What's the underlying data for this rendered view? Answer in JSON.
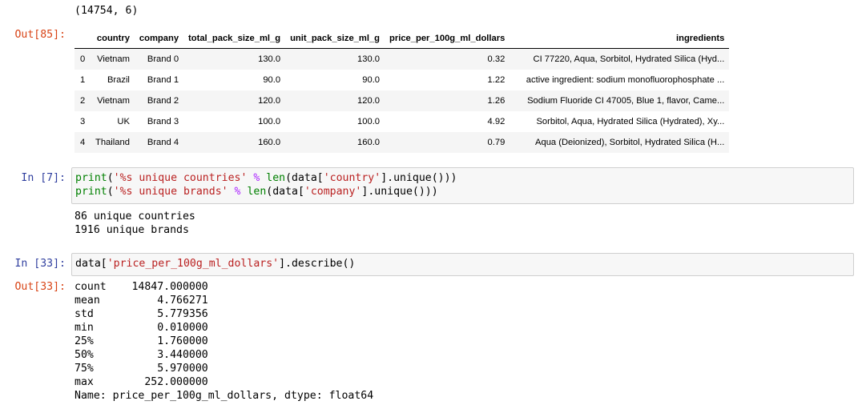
{
  "top_output": {
    "text": "(14754, 6)"
  },
  "out85": {
    "prompt": "Out[85]:",
    "columns": [
      "",
      "country",
      "company",
      "total_pack_size_ml_g",
      "unit_pack_size_ml_g",
      "price_per_100g_ml_dollars",
      "ingredients"
    ],
    "rows": [
      [
        "0",
        "Vietnam",
        "Brand 0",
        "130.0",
        "130.0",
        "0.32",
        "CI 77220, Aqua, Sorbitol, Hydrated Silica (Hyd..."
      ],
      [
        "1",
        "Brazil",
        "Brand 1",
        "90.0",
        "90.0",
        "1.22",
        "active ingredient: sodium monofluorophosphate ..."
      ],
      [
        "2",
        "Vietnam",
        "Brand 2",
        "120.0",
        "120.0",
        "1.26",
        "Sodium Fluoride CI 47005, Blue 1, flavor, Came..."
      ],
      [
        "3",
        "UK",
        "Brand 3",
        "100.0",
        "100.0",
        "4.92",
        "Sorbitol, Aqua, Hydrated Silica (Hydrated), Xy..."
      ],
      [
        "4",
        "Thailand",
        "Brand 4",
        "160.0",
        "160.0",
        "0.79",
        "Aqua (Deionized), Sorbitol, Hydrated Silica (H..."
      ]
    ]
  },
  "in7": {
    "prompt": "In [7]:",
    "line1": {
      "print": "print",
      "open": "(",
      "str": "'%s unique countries'",
      "op": "%",
      "len": "len",
      "p1": "(data[",
      "key": "'country'",
      "p2": "].unique()))"
    },
    "line2": {
      "print": "print",
      "open": "(",
      "str": "'%s unique brands'",
      "op": "%",
      "len": "len",
      "p1": "(data[",
      "key": "'company'",
      "p2": "].unique()))"
    },
    "output_lines": [
      "86 unique countries",
      "1916 unique brands"
    ]
  },
  "in33": {
    "prompt": "In [33]:",
    "code": {
      "a": "data[",
      "key": "'price_per_100g_ml_dollars'",
      "b": "].describe()"
    }
  },
  "out33": {
    "prompt": "Out[33]:",
    "lines": [
      "count    14847.000000",
      "mean         4.766271",
      "std          5.779356",
      "min          0.010000",
      "25%          1.760000",
      "50%          3.440000",
      "75%          5.970000",
      "max        252.000000",
      "Name: price_per_100g_ml_dollars, dtype: float64"
    ]
  },
  "colors": {
    "out_prompt": "#d84315",
    "in_prompt": "#303f9f",
    "string": "#ba2121",
    "builtin": "#008000",
    "operator": "#aa22ff",
    "cell_bg": "#f7f7f7",
    "cell_border": "#cfcfcf"
  }
}
